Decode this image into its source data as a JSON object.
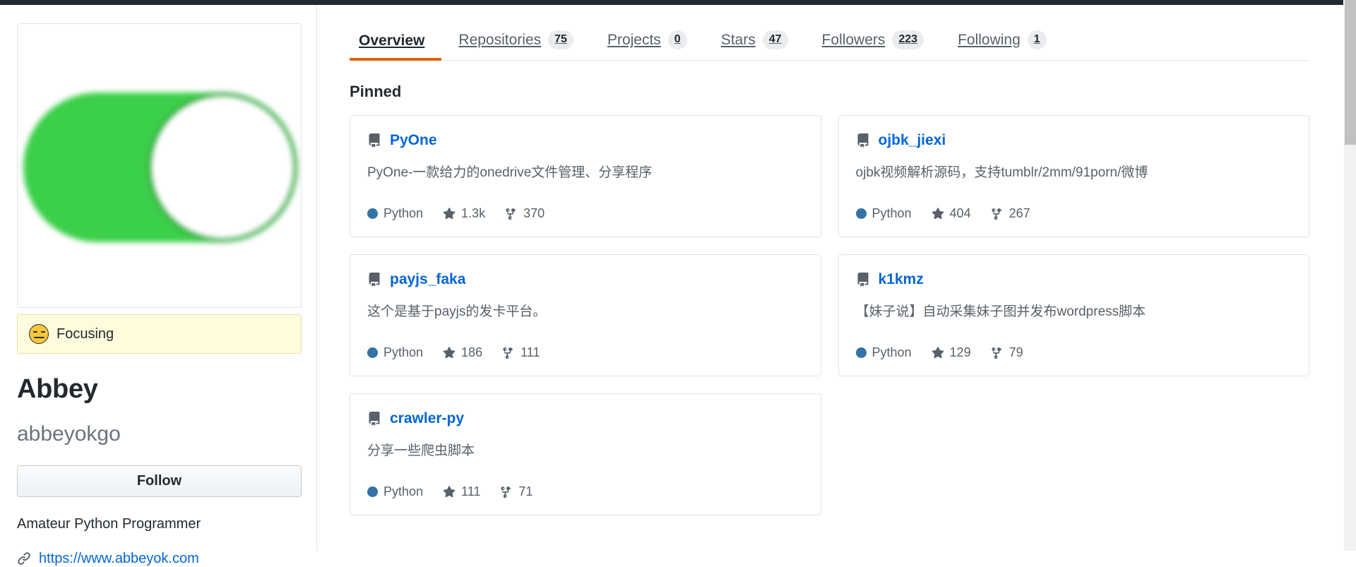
{
  "colors": {
    "accent_orange": "#e36209",
    "link_blue": "#0366d6",
    "python_dot": "#3572A5",
    "status_bg": "#fffbdd",
    "avatar_green": "#3ccf4a",
    "border": "#e1e4e8",
    "muted_text": "#586069"
  },
  "profile": {
    "avatar_alt": "toggle-switch-on-avatar",
    "status": {
      "emoji_name": "expressionless-face-emoji",
      "text": "Focusing"
    },
    "name": "Abbey",
    "login": "abbeyokgo",
    "follow_label": "Follow",
    "bio": "Amateur Python Programmer",
    "website": {
      "icon_name": "link-icon",
      "url": "https://www.abbeyok.com"
    }
  },
  "tabs": [
    {
      "label": "Overview",
      "count": null,
      "active": true
    },
    {
      "label": "Repositories",
      "count": "75",
      "active": false
    },
    {
      "label": "Projects",
      "count": "0",
      "active": false
    },
    {
      "label": "Stars",
      "count": "47",
      "active": false
    },
    {
      "label": "Followers",
      "count": "223",
      "active": false
    },
    {
      "label": "Following",
      "count": "1",
      "active": false
    }
  ],
  "pinned": {
    "heading": "Pinned",
    "repos": [
      {
        "name": "PyOne",
        "description": "PyOne-一款给力的onedrive文件管理、分享程序",
        "language": "Python",
        "stars": "1.3k",
        "forks": "370"
      },
      {
        "name": "ojbk_jiexi",
        "description": "ojbk视频解析源码，支持tumblr/2mm/91porn/微博",
        "language": "Python",
        "stars": "404",
        "forks": "267"
      },
      {
        "name": "payjs_faka",
        "description": "这个是基于payjs的发卡平台。",
        "language": "Python",
        "stars": "186",
        "forks": "111"
      },
      {
        "name": "k1kmz",
        "description": "【妹子说】自动采集妹子图并发布wordpress脚本",
        "language": "Python",
        "stars": "129",
        "forks": "79"
      },
      {
        "name": "crawler-py",
        "description": "分享一些爬虫脚本",
        "language": "Python",
        "stars": "111",
        "forks": "71"
      }
    ]
  }
}
